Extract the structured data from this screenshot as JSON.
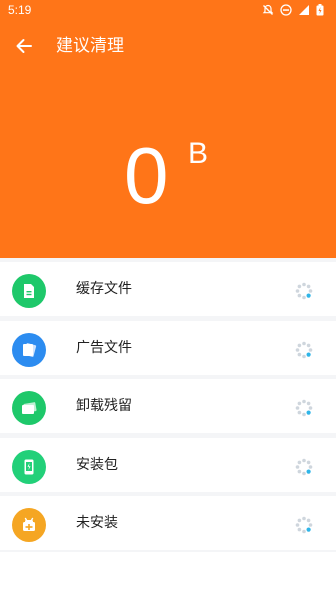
{
  "status_bar": {
    "time": "5:19",
    "icons": [
      "notifications-off-icon",
      "do-not-disturb-icon",
      "signal-icon",
      "battery-charging-icon"
    ]
  },
  "app_bar": {
    "title": "建议清理",
    "back_icon": "arrow-left-icon"
  },
  "summary": {
    "size_value": "0",
    "size_unit": "B"
  },
  "items": [
    {
      "label": "缓存文件",
      "icon": "cache-file-icon",
      "color": "#1ec86a"
    },
    {
      "label": "广告文件",
      "icon": "ad-file-icon",
      "color": "#2c8cf0"
    },
    {
      "label": "卸载残留",
      "icon": "uninstall-residue-icon",
      "color": "#1ec86a"
    },
    {
      "label": "安装包",
      "icon": "apk-package-icon",
      "color": "#22d079"
    },
    {
      "label": "未安装",
      "icon": "not-installed-icon",
      "color": "#f5a623"
    }
  ],
  "colors": {
    "header_bg": "#ff7518",
    "spinner": "#cfd6dd",
    "spinner_accent": "#2fb5e8"
  }
}
